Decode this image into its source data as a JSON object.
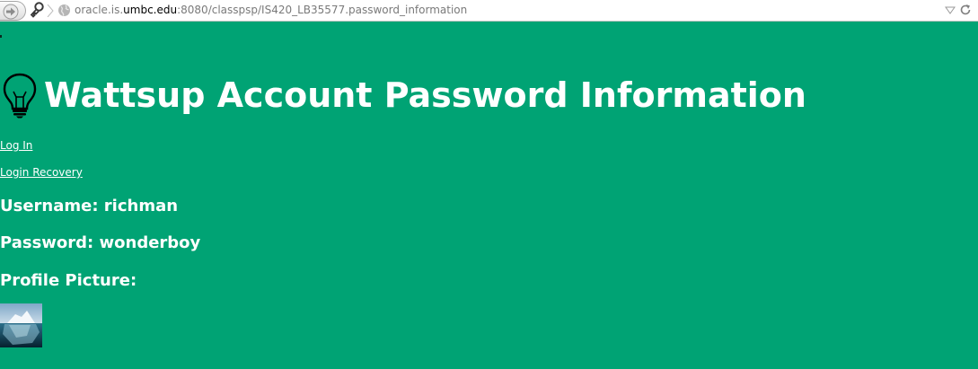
{
  "browser": {
    "url_host_prefix": "oracle.is.",
    "url_host_domain": "umbc.edu",
    "url_path": ":8080/classpsp/IS420_LB35577.password_information",
    "icons": {
      "forward": "forward-arrow-icon",
      "identity": "key-icon",
      "site": "globe-icon",
      "dropdown": "dropdown-arrow-icon",
      "reload": "reload-icon"
    }
  },
  "page": {
    "background_color": "#00a374",
    "title": "Wattsup Account Password Information",
    "title_icon": "lightbulb-icon",
    "links": {
      "login": "Log In",
      "recovery": "Login Recovery"
    },
    "username": "Username: richman",
    "password": "Password: wonderboy",
    "profile_picture_label": "Profile Picture:",
    "profile_picture": "iceberg-photo"
  }
}
